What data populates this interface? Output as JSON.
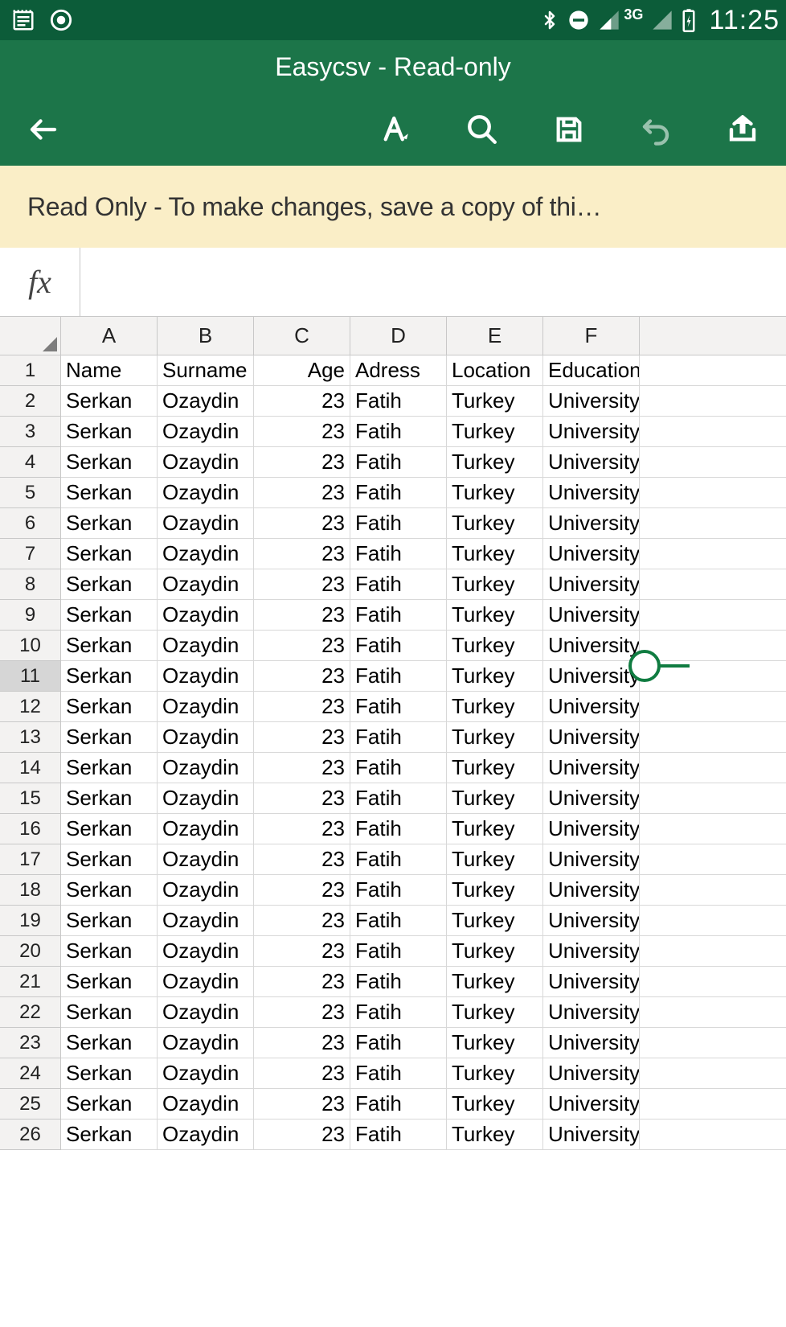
{
  "status": {
    "network": "3G",
    "time": "11:25"
  },
  "app": {
    "title": "Easycsv - Read-only"
  },
  "banner": {
    "text": "Read Only - To make changes, save a copy of thi…"
  },
  "fx": {
    "label": "fx",
    "value": ""
  },
  "columns": [
    "A",
    "B",
    "C",
    "D",
    "E",
    "F"
  ],
  "header_row": [
    "Name",
    "Surname",
    "Age",
    "Adress",
    "Location",
    "Education"
  ],
  "data": [
    [
      "Serkan",
      "Ozaydin",
      "23",
      "Fatih",
      "Turkey",
      "University"
    ],
    [
      "Serkan",
      "Ozaydin",
      "23",
      "Fatih",
      "Turkey",
      "University"
    ],
    [
      "Serkan",
      "Ozaydin",
      "23",
      "Fatih",
      "Turkey",
      "University"
    ],
    [
      "Serkan",
      "Ozaydin",
      "23",
      "Fatih",
      "Turkey",
      "University"
    ],
    [
      "Serkan",
      "Ozaydin",
      "23",
      "Fatih",
      "Turkey",
      "University"
    ],
    [
      "Serkan",
      "Ozaydin",
      "23",
      "Fatih",
      "Turkey",
      "University"
    ],
    [
      "Serkan",
      "Ozaydin",
      "23",
      "Fatih",
      "Turkey",
      "University"
    ],
    [
      "Serkan",
      "Ozaydin",
      "23",
      "Fatih",
      "Turkey",
      "University"
    ],
    [
      "Serkan",
      "Ozaydin",
      "23",
      "Fatih",
      "Turkey",
      "University"
    ],
    [
      "Serkan",
      "Ozaydin",
      "23",
      "Fatih",
      "Turkey",
      "University"
    ],
    [
      "Serkan",
      "Ozaydin",
      "23",
      "Fatih",
      "Turkey",
      "University"
    ],
    [
      "Serkan",
      "Ozaydin",
      "23",
      "Fatih",
      "Turkey",
      "University"
    ],
    [
      "Serkan",
      "Ozaydin",
      "23",
      "Fatih",
      "Turkey",
      "University"
    ],
    [
      "Serkan",
      "Ozaydin",
      "23",
      "Fatih",
      "Turkey",
      "University"
    ],
    [
      "Serkan",
      "Ozaydin",
      "23",
      "Fatih",
      "Turkey",
      "University"
    ],
    [
      "Serkan",
      "Ozaydin",
      "23",
      "Fatih",
      "Turkey",
      "University"
    ],
    [
      "Serkan",
      "Ozaydin",
      "23",
      "Fatih",
      "Turkey",
      "University"
    ],
    [
      "Serkan",
      "Ozaydin",
      "23",
      "Fatih",
      "Turkey",
      "University"
    ],
    [
      "Serkan",
      "Ozaydin",
      "23",
      "Fatih",
      "Turkey",
      "University"
    ],
    [
      "Serkan",
      "Ozaydin",
      "23",
      "Fatih",
      "Turkey",
      "University"
    ],
    [
      "Serkan",
      "Ozaydin",
      "23",
      "Fatih",
      "Turkey",
      "University"
    ],
    [
      "Serkan",
      "Ozaydin",
      "23",
      "Fatih",
      "Turkey",
      "University"
    ],
    [
      "Serkan",
      "Ozaydin",
      "23",
      "Fatih",
      "Turkey",
      "University"
    ],
    [
      "Serkan",
      "Ozaydin",
      "23",
      "Fatih",
      "Turkey",
      "University"
    ],
    [
      "Serkan",
      "Ozaydin",
      "23",
      "Fatih",
      "Turkey",
      "University"
    ]
  ],
  "selected_row": 11,
  "chart_data": {
    "type": "table",
    "title": "Easycsv",
    "columns": [
      "Name",
      "Surname",
      "Age",
      "Adress",
      "Location",
      "Education"
    ],
    "rows": [
      [
        "Serkan",
        "Ozaydin",
        23,
        "Fatih",
        "Turkey",
        "University"
      ],
      [
        "Serkan",
        "Ozaydin",
        23,
        "Fatih",
        "Turkey",
        "University"
      ],
      [
        "Serkan",
        "Ozaydin",
        23,
        "Fatih",
        "Turkey",
        "University"
      ],
      [
        "Serkan",
        "Ozaydin",
        23,
        "Fatih",
        "Turkey",
        "University"
      ],
      [
        "Serkan",
        "Ozaydin",
        23,
        "Fatih",
        "Turkey",
        "University"
      ],
      [
        "Serkan",
        "Ozaydin",
        23,
        "Fatih",
        "Turkey",
        "University"
      ],
      [
        "Serkan",
        "Ozaydin",
        23,
        "Fatih",
        "Turkey",
        "University"
      ],
      [
        "Serkan",
        "Ozaydin",
        23,
        "Fatih",
        "Turkey",
        "University"
      ],
      [
        "Serkan",
        "Ozaydin",
        23,
        "Fatih",
        "Turkey",
        "University"
      ],
      [
        "Serkan",
        "Ozaydin",
        23,
        "Fatih",
        "Turkey",
        "University"
      ],
      [
        "Serkan",
        "Ozaydin",
        23,
        "Fatih",
        "Turkey",
        "University"
      ],
      [
        "Serkan",
        "Ozaydin",
        23,
        "Fatih",
        "Turkey",
        "University"
      ],
      [
        "Serkan",
        "Ozaydin",
        23,
        "Fatih",
        "Turkey",
        "University"
      ],
      [
        "Serkan",
        "Ozaydin",
        23,
        "Fatih",
        "Turkey",
        "University"
      ],
      [
        "Serkan",
        "Ozaydin",
        23,
        "Fatih",
        "Turkey",
        "University"
      ],
      [
        "Serkan",
        "Ozaydin",
        23,
        "Fatih",
        "Turkey",
        "University"
      ],
      [
        "Serkan",
        "Ozaydin",
        23,
        "Fatih",
        "Turkey",
        "University"
      ],
      [
        "Serkan",
        "Ozaydin",
        23,
        "Fatih",
        "Turkey",
        "University"
      ],
      [
        "Serkan",
        "Ozaydin",
        23,
        "Fatih",
        "Turkey",
        "University"
      ],
      [
        "Serkan",
        "Ozaydin",
        23,
        "Fatih",
        "Turkey",
        "University"
      ],
      [
        "Serkan",
        "Ozaydin",
        23,
        "Fatih",
        "Turkey",
        "University"
      ],
      [
        "Serkan",
        "Ozaydin",
        23,
        "Fatih",
        "Turkey",
        "University"
      ],
      [
        "Serkan",
        "Ozaydin",
        23,
        "Fatih",
        "Turkey",
        "University"
      ],
      [
        "Serkan",
        "Ozaydin",
        23,
        "Fatih",
        "Turkey",
        "University"
      ],
      [
        "Serkan",
        "Ozaydin",
        23,
        "Fatih",
        "Turkey",
        "University"
      ]
    ]
  }
}
